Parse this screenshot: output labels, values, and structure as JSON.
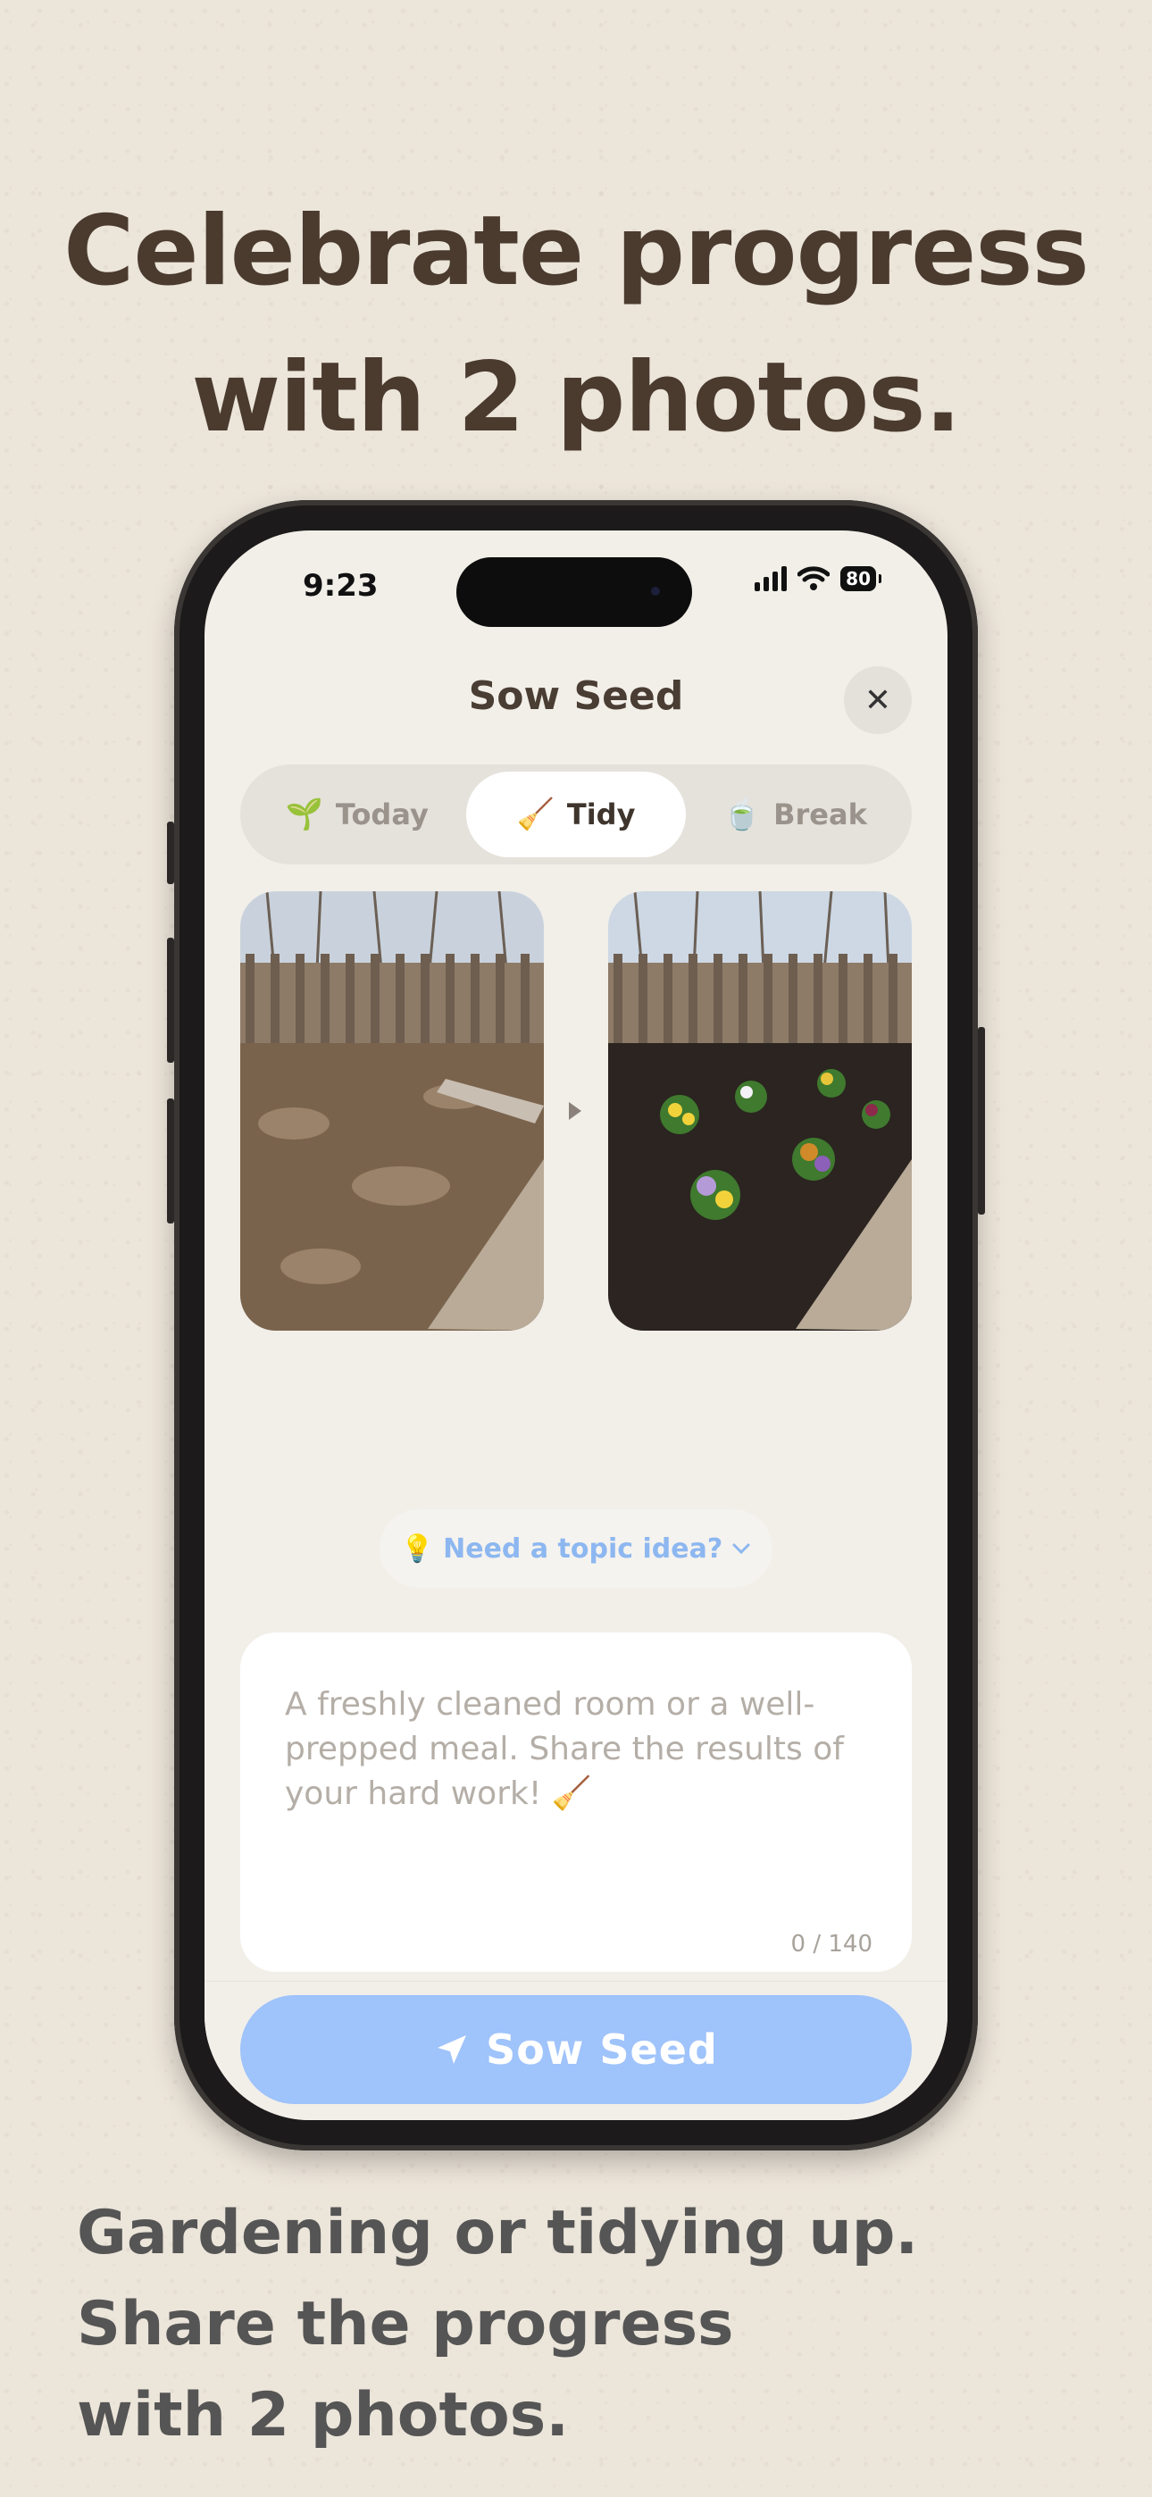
{
  "headline": [
    "Celebrate progress",
    "with 2 photos."
  ],
  "status": {
    "time": "9:23",
    "battery": "80"
  },
  "sheet": {
    "title": "Sow Seed",
    "close_icon": "close-icon",
    "tabs": [
      {
        "emoji": "🌱",
        "label": "Today",
        "active": false
      },
      {
        "emoji": "🧹",
        "label": "Tidy",
        "active": true
      },
      {
        "emoji": "🍵",
        "label": "Break",
        "active": false
      }
    ],
    "photos": [
      "before-garden-bed-photo",
      "after-garden-bed-photo"
    ],
    "topic_button": {
      "emoji": "💡",
      "label": "Need a topic idea?",
      "icon": "chevron-down-icon"
    },
    "input": {
      "placeholder": "A freshly cleaned room or a well-prepped meal. Share the results of your hard work! 🧹",
      "counter": "0 / 140"
    },
    "submit": {
      "icon": "send-icon",
      "label": "Sow Seed"
    }
  },
  "caption": [
    "Gardening or tidying up.",
    "Share the progress",
    "with 2 photos."
  ],
  "colors": {
    "background": "#ece5da",
    "accent": "#9fc3fb",
    "headline": "#4a3b2e"
  }
}
